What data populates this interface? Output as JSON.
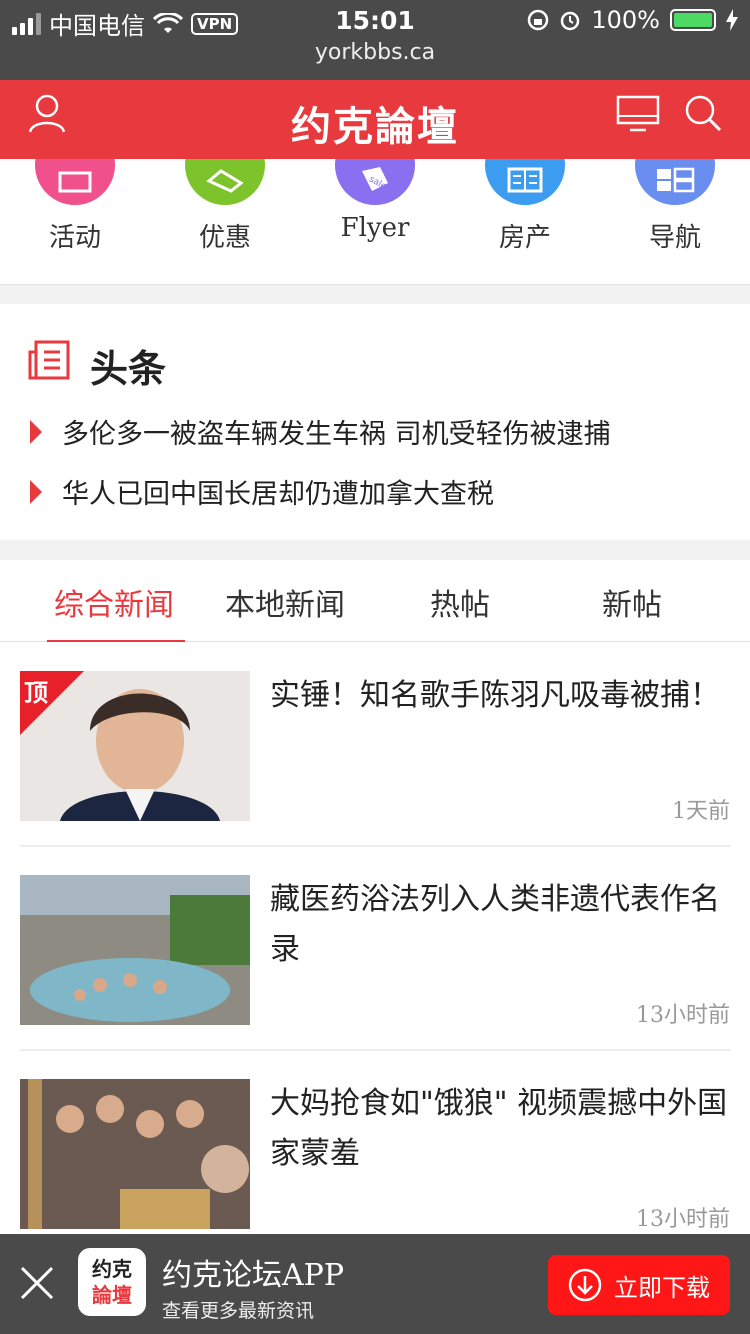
{
  "status_bar": {
    "carrier": "中国电信",
    "vpn": "VPN",
    "time": "15:01",
    "url": "yorkbbs.ca",
    "battery": "100%"
  },
  "header": {
    "logo": "约克論壇",
    "user_icon": "user-icon",
    "desktop_icon": "monitor-icon",
    "search_icon": "search-icon"
  },
  "quick_nav": [
    {
      "label": "活动",
      "color": "#f0508c",
      "icon": "calendar-icon"
    },
    {
      "label": "优惠",
      "color": "#7dc32b",
      "icon": "tag-icon"
    },
    {
      "label": "Flyer",
      "color": "#8a6ff0",
      "icon": "sale-tag-icon"
    },
    {
      "label": "房产",
      "color": "#3c9cf0",
      "icon": "building-icon"
    },
    {
      "label": "导航",
      "color": "#6a8ef0",
      "icon": "grid-icon"
    }
  ],
  "headlines": {
    "title": "头条",
    "items": [
      "多伦多一被盗车辆发生车祸 司机受轻伤被逮捕",
      "华人已回中国长居却仍遭加拿大查税"
    ]
  },
  "tabs": [
    "综合新闻",
    "本地新闻",
    "热帖",
    "新帖"
  ],
  "active_tab": 0,
  "news": [
    {
      "title": "实锤！知名歌手陈羽凡吸毒被捕！",
      "time": "1天前",
      "pinned": true,
      "badge": "顶"
    },
    {
      "title": "藏医药浴法列入人类非遗代表作名录",
      "time": "13小时前",
      "pinned": false
    },
    {
      "title": "大妈抢食如\"饿狼\" 视频震撼中外国家蒙羞",
      "time": "13小时前",
      "pinned": false
    }
  ],
  "banner": {
    "icon_line1": "约克",
    "icon_line2": "論壇",
    "title": "约克论坛APP",
    "subtitle": "查看更多最新资讯",
    "button": "立即下载"
  },
  "colors": {
    "brand_red": "#e8393f",
    "status_bar": "#4a4a4a",
    "download_red": "#ff1616"
  }
}
